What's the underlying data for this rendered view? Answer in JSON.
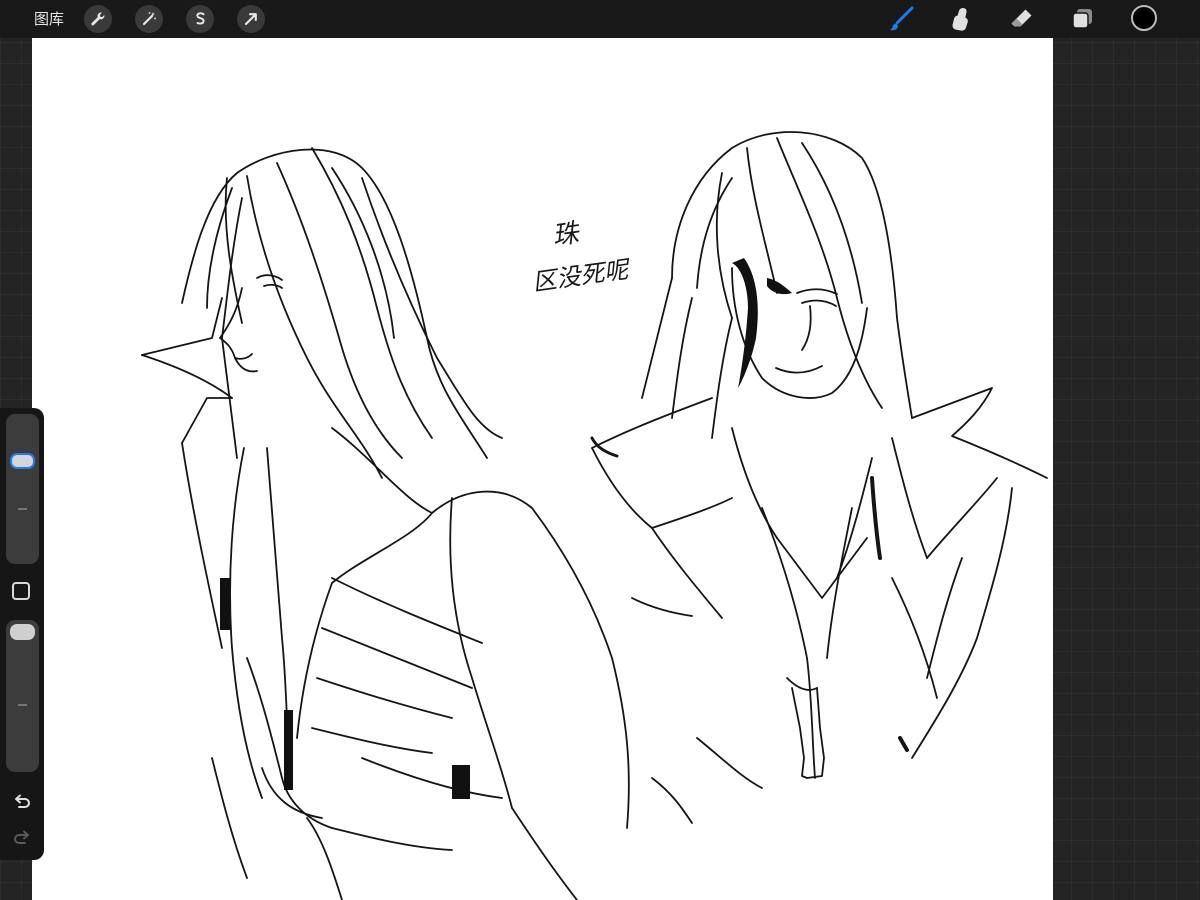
{
  "topbar": {
    "gallery_label": "图库",
    "left_tools": [
      {
        "name": "actions",
        "icon": "wrench-icon"
      },
      {
        "name": "adjustments",
        "icon": "magic-wand-icon"
      },
      {
        "name": "selection",
        "icon": "selection-s-icon"
      },
      {
        "name": "transform",
        "icon": "arrow-cursor-icon"
      }
    ],
    "right_tools": [
      {
        "name": "brush",
        "icon": "brush-icon",
        "active": true
      },
      {
        "name": "smudge",
        "icon": "smudge-finger-icon",
        "active": false
      },
      {
        "name": "eraser",
        "icon": "eraser-icon",
        "active": false
      },
      {
        "name": "layers",
        "icon": "layers-icon",
        "active": false
      }
    ],
    "current_color": "#000000"
  },
  "colors": {
    "accent": "#1e7cf2",
    "canvas": "#ffffff",
    "ink": "#111111"
  },
  "sidebar": {
    "brush_size_level": 0.72,
    "opacity_level": 1.0,
    "undo_icon": "undo-icon",
    "redo_icon": "redo-icon"
  },
  "canvas": {
    "note_line1": "珠",
    "note_line2": "区没死呢"
  }
}
